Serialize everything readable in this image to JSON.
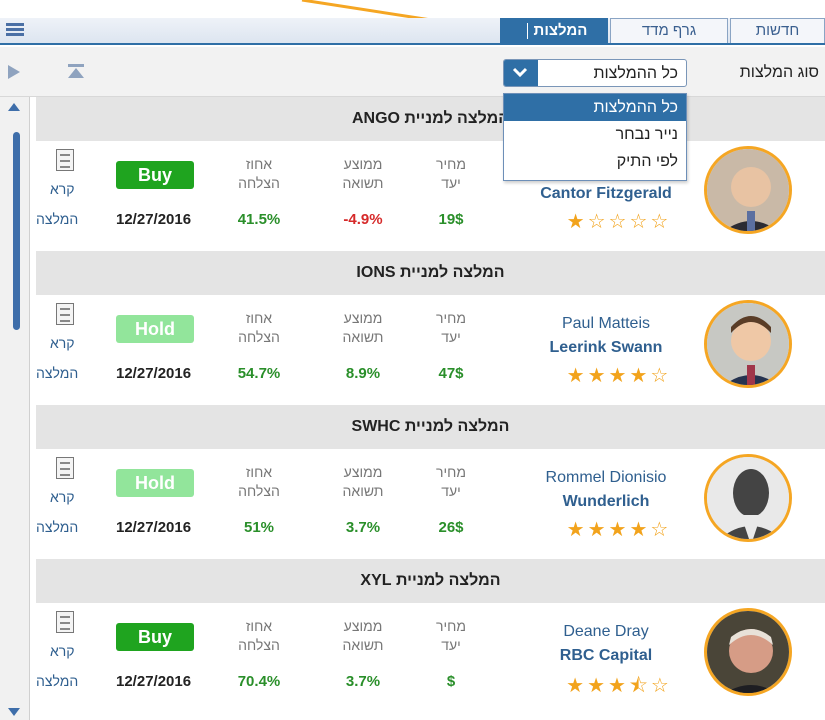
{
  "tabs": {
    "recommendations": "המלצות",
    "index_graph": "גרף מדד",
    "news": "חדשות"
  },
  "filter": {
    "label": "סוג המלצות",
    "selected": "כל ההמלצות"
  },
  "dropdown": {
    "options": [
      "כל ההמלצות",
      "נייר נבחר",
      "לפי התיק"
    ]
  },
  "columns": {
    "price_line1": "מחיר",
    "price_line2": "יעד",
    "return_line1": "ממוצע",
    "return_line2": "תשואה",
    "success_line1": "אחוז",
    "success_line2": "הצלחה",
    "read_line1": "קרא",
    "read_line2": "המלצה"
  },
  "colors": {
    "accent": "#2f6fa6",
    "buy": "#1fa41f",
    "hold": "#92e59b",
    "star": "#f2a31c",
    "positive": "#2a8f2a",
    "negative": "#d62a2a"
  },
  "cards": [
    {
      "header": "המלצה למניית ANGO",
      "analyst": "",
      "firm": "Cantor Fitzgerald",
      "rating": 1,
      "target": "19$",
      "avg_return": "-4.9%",
      "success": "41.5%",
      "action": "Buy",
      "date": "12/27/2016"
    },
    {
      "header": "המלצה למניית IONS",
      "analyst": "Paul Matteis",
      "firm": "Leerink Swann",
      "rating": 4,
      "target": "47$",
      "avg_return": "8.9%",
      "success": "54.7%",
      "action": "Hold",
      "date": "12/27/2016"
    },
    {
      "header": "המלצה למניית SWHC",
      "analyst": "Rommel Dionisio",
      "firm": "Wunderlich",
      "rating": 4,
      "target": "26$",
      "avg_return": "3.7%",
      "success": "51%",
      "action": "Hold",
      "date": "12/27/2016"
    },
    {
      "header": "המלצה למניית XYL",
      "analyst": "Deane Dray",
      "firm": "RBC Capital",
      "rating": 3.5,
      "target": "$",
      "avg_return": "3.7%",
      "success": "70.4%",
      "action": "Buy",
      "date": "12/27/2016"
    }
  ]
}
